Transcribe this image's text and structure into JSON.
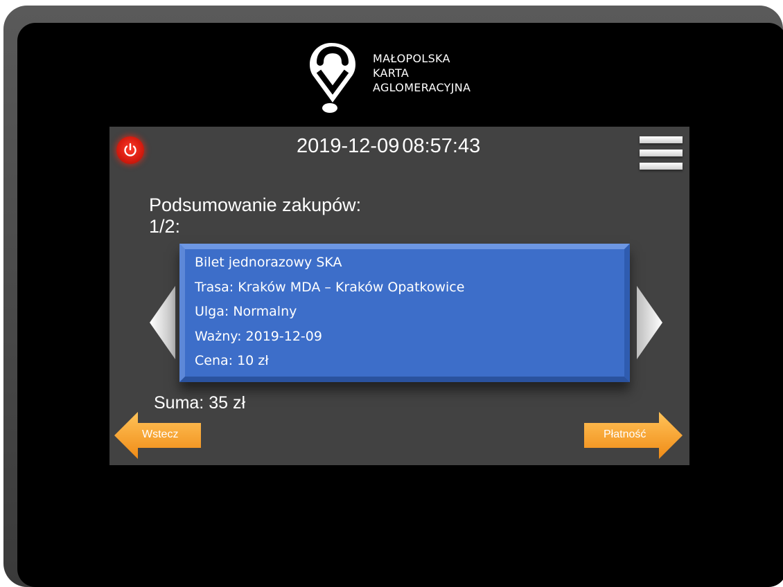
{
  "brand": {
    "line1": "MAŁOPOLSKA",
    "line2": "KARTA",
    "line3": "AGLOMERACYJNA",
    "icon": "location-pin-logo"
  },
  "header": {
    "date": "2019-12-09",
    "time": "08:57:43",
    "power_icon": "power-icon",
    "menu_icon": "hamburger-menu-icon"
  },
  "summary": {
    "title": "Podsumowanie zakupów:",
    "page": "1/2:",
    "total": "Suma: 35 zł"
  },
  "ticket": {
    "name": "Bilet jednorazowy SKA",
    "route": "Trasa: Kraków MDA – Kraków Opatkowice",
    "discount": "Ulga: Normalny",
    "valid": "Ważny: 2019-12-09",
    "price": "Cena: 10 zł"
  },
  "buttons": {
    "back": "Wstecz",
    "payment": "Płatność"
  },
  "colors": {
    "screen_bg": "#424242",
    "card_blue": "#3d6ec9",
    "nav_orange": "#f5a12a",
    "power_red": "#e32b1a"
  }
}
